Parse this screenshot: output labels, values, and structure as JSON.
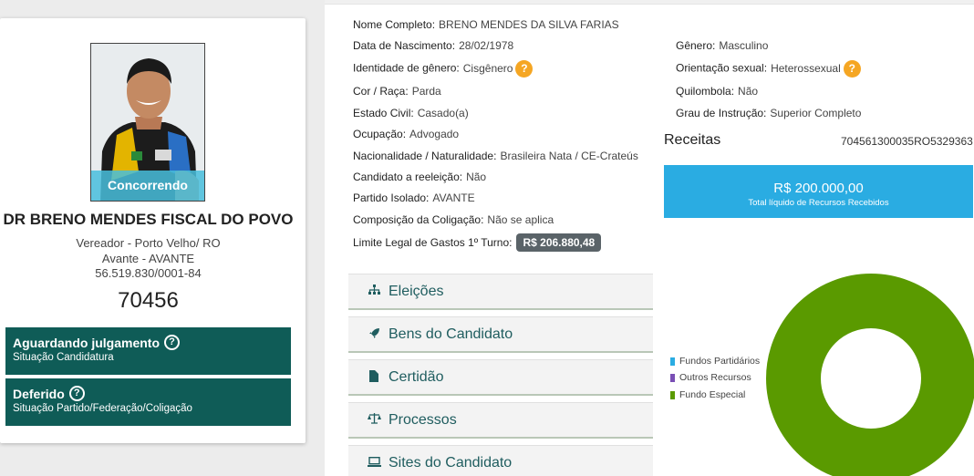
{
  "candidate": {
    "photo_badge": "Concorrendo",
    "name": "DR BRENO MENDES FISCAL DO POVO",
    "office": "Vereador - Porto Velho/ RO",
    "party": "Avante - AVANTE",
    "cnpj": "56.519.830/0001-84",
    "number": "70456",
    "status1_title": "Aguardando julgamento",
    "status1_sub": "Situação Candidatura",
    "status2_title": "Deferido",
    "status2_sub": "Situação Partido/Federação/Coligação"
  },
  "details": {
    "nome_lbl": "Nome Completo:",
    "nome_val": "BRENO MENDES DA SILVA FARIAS",
    "nasc_lbl": "Data de Nascimento:",
    "nasc_val": "28/02/1978",
    "genero_lbl": "Gênero:",
    "genero_val": "Masculino",
    "ident_lbl": "Identidade de gênero:",
    "ident_val": "Cisgênero",
    "orient_lbl": "Orientação sexual:",
    "orient_val": "Heterossexual",
    "cor_lbl": "Cor / Raça:",
    "cor_val": "Parda",
    "quil_lbl": "Quilombola:",
    "quil_val": "Não",
    "civil_lbl": "Estado Civil:",
    "civil_val": "Casado(a)",
    "grau_lbl": "Grau de Instrução:",
    "grau_val": "Superior Completo",
    "ocup_lbl": "Ocupação:",
    "ocup_val": "Advogado",
    "nac_lbl": "Nacionalidade / Naturalidade:",
    "nac_val": "Brasileira Nata / CE-Crateús",
    "reel_lbl": "Candidato a reeleição:",
    "reel_val": "Não",
    "part_lbl": "Partido Isolado:",
    "part_val": "AVANTE",
    "comp_lbl": "Composição da Coligação:",
    "comp_val": "Não se aplica",
    "lim_lbl": "Limite Legal de Gastos 1º Turno:",
    "lim_val": "R$ 206.880,48",
    "help": "?"
  },
  "accordion": [
    "Eleições",
    "Bens do Candidato",
    "Certidão",
    "Processos",
    "Sites do Candidato"
  ],
  "receitas": {
    "title": "Receitas",
    "code": "704561300035RO5329363",
    "amount": "R$ 200.000,00",
    "subtitle": "Total líquido de Recursos Recebidos"
  },
  "chart_data": {
    "type": "pie",
    "categories": [
      "Fundos Partidários",
      "Outros Recursos",
      "Fundo Especial"
    ],
    "values": [
      0,
      0,
      200000
    ],
    "colors": [
      "#2aace2",
      "#7a4fb5",
      "#5a9a00"
    ],
    "legend": "left"
  }
}
